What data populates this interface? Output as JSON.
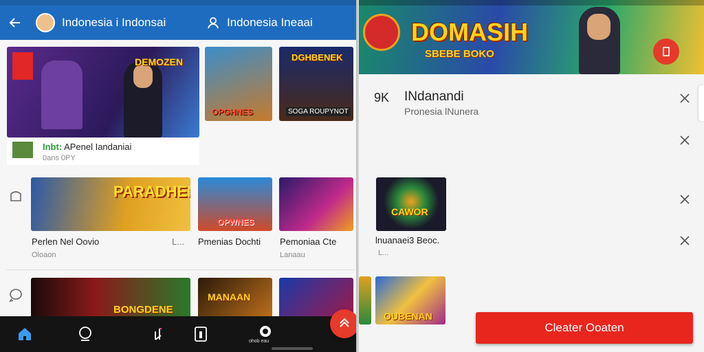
{
  "left": {
    "appbar": {
      "title": "Indonesia i Indonsai",
      "title2": "Indonesia Ineaai"
    },
    "featured": {
      "banner": "DEMOZEN",
      "name_prefix": "Inbt:",
      "name": "APenel Iandaniai",
      "sub": "0ans 0PY"
    },
    "tiles_top": [
      {
        "banner": "OPGHNES"
      },
      {
        "banner": "DGHBENEK",
        "sub": "SOGA ROUPYNOT"
      }
    ],
    "row2": {
      "cards": [
        {
          "banner": "PARADHEN!",
          "title": "Perlen Nel Oovio",
          "sub": "Oloaon",
          "more": "L..."
        },
        {
          "banner": "OPWNES",
          "title": "Pmenias Dochti",
          "sub": ""
        },
        {
          "banner": "",
          "title": "Pemoniaa Cte",
          "sub": "Lanaau"
        }
      ]
    },
    "row3": {
      "cards": [
        {
          "banner": "BONGDENE"
        },
        {
          "banner": "MANAAN"
        },
        {
          "banner": ""
        }
      ]
    },
    "bottomnav": {
      "cam_label": "ohob eau"
    }
  },
  "right": {
    "hero": {
      "title": "DOMASIH",
      "sub": "SBEBE BOKO"
    },
    "sheet": {
      "sk": "9K",
      "title": "INdanandi",
      "sub": "Pronesia lNunera"
    },
    "card": {
      "banner": "CAWOR",
      "title": "lnuanaei3 Beoc.",
      "sub": "L..."
    },
    "card2": {
      "banner": "OUBENAN"
    },
    "clear_button": "Cleater Ooaten"
  },
  "colors": {
    "appbar": "#1e6cc0",
    "accent_red": "#e8261e",
    "nav_bg": "#141414"
  }
}
